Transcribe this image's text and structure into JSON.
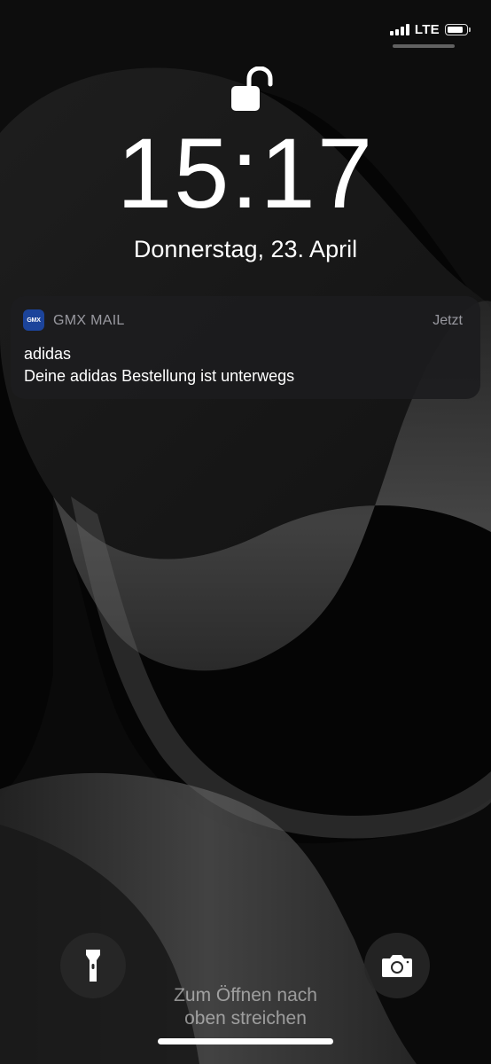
{
  "status_bar": {
    "network": "LTE",
    "signal_bars": 4,
    "battery_level": 0.8
  },
  "lock_screen": {
    "time": "15:17",
    "date": "Donnerstag, 23. April",
    "unlock_hint_line1": "Zum Öffnen nach",
    "unlock_hint_line2": "oben streichen"
  },
  "notification": {
    "app_icon_text": "GMX",
    "app_name": "GMX MAIL",
    "time": "Jetzt",
    "title": "adidas",
    "body": "Deine adidas Bestellung ist unterwegs"
  },
  "colors": {
    "background": "#000000",
    "gmx_brand": "#1c449b",
    "notification_bg": "#1c1c1e"
  },
  "icons": {
    "flashlight": "flashlight-icon",
    "camera": "camera-icon",
    "lock": "lock-open-icon"
  }
}
